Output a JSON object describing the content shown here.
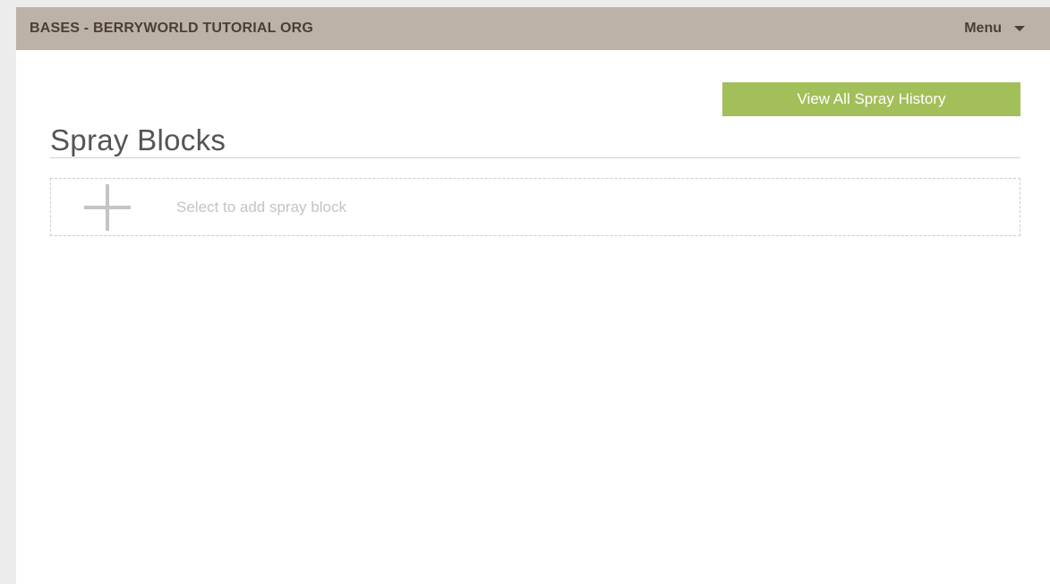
{
  "header": {
    "org_title": "BASES - BERRYWORLD TUTORIAL ORG",
    "menu_label": "Menu",
    "menu_icon": "caret-down-icon"
  },
  "actions": {
    "view_history_label": "View All Spray History"
  },
  "main": {
    "title": "Spray Blocks",
    "add_block_label": "Select to add spray block",
    "add_icon": "plus-icon"
  },
  "colors": {
    "header_bg": "#bdb2a7",
    "header_text": "#4a3f36",
    "accent_button": "#a3bf5a",
    "placeholder_text": "#c4c4c4"
  }
}
